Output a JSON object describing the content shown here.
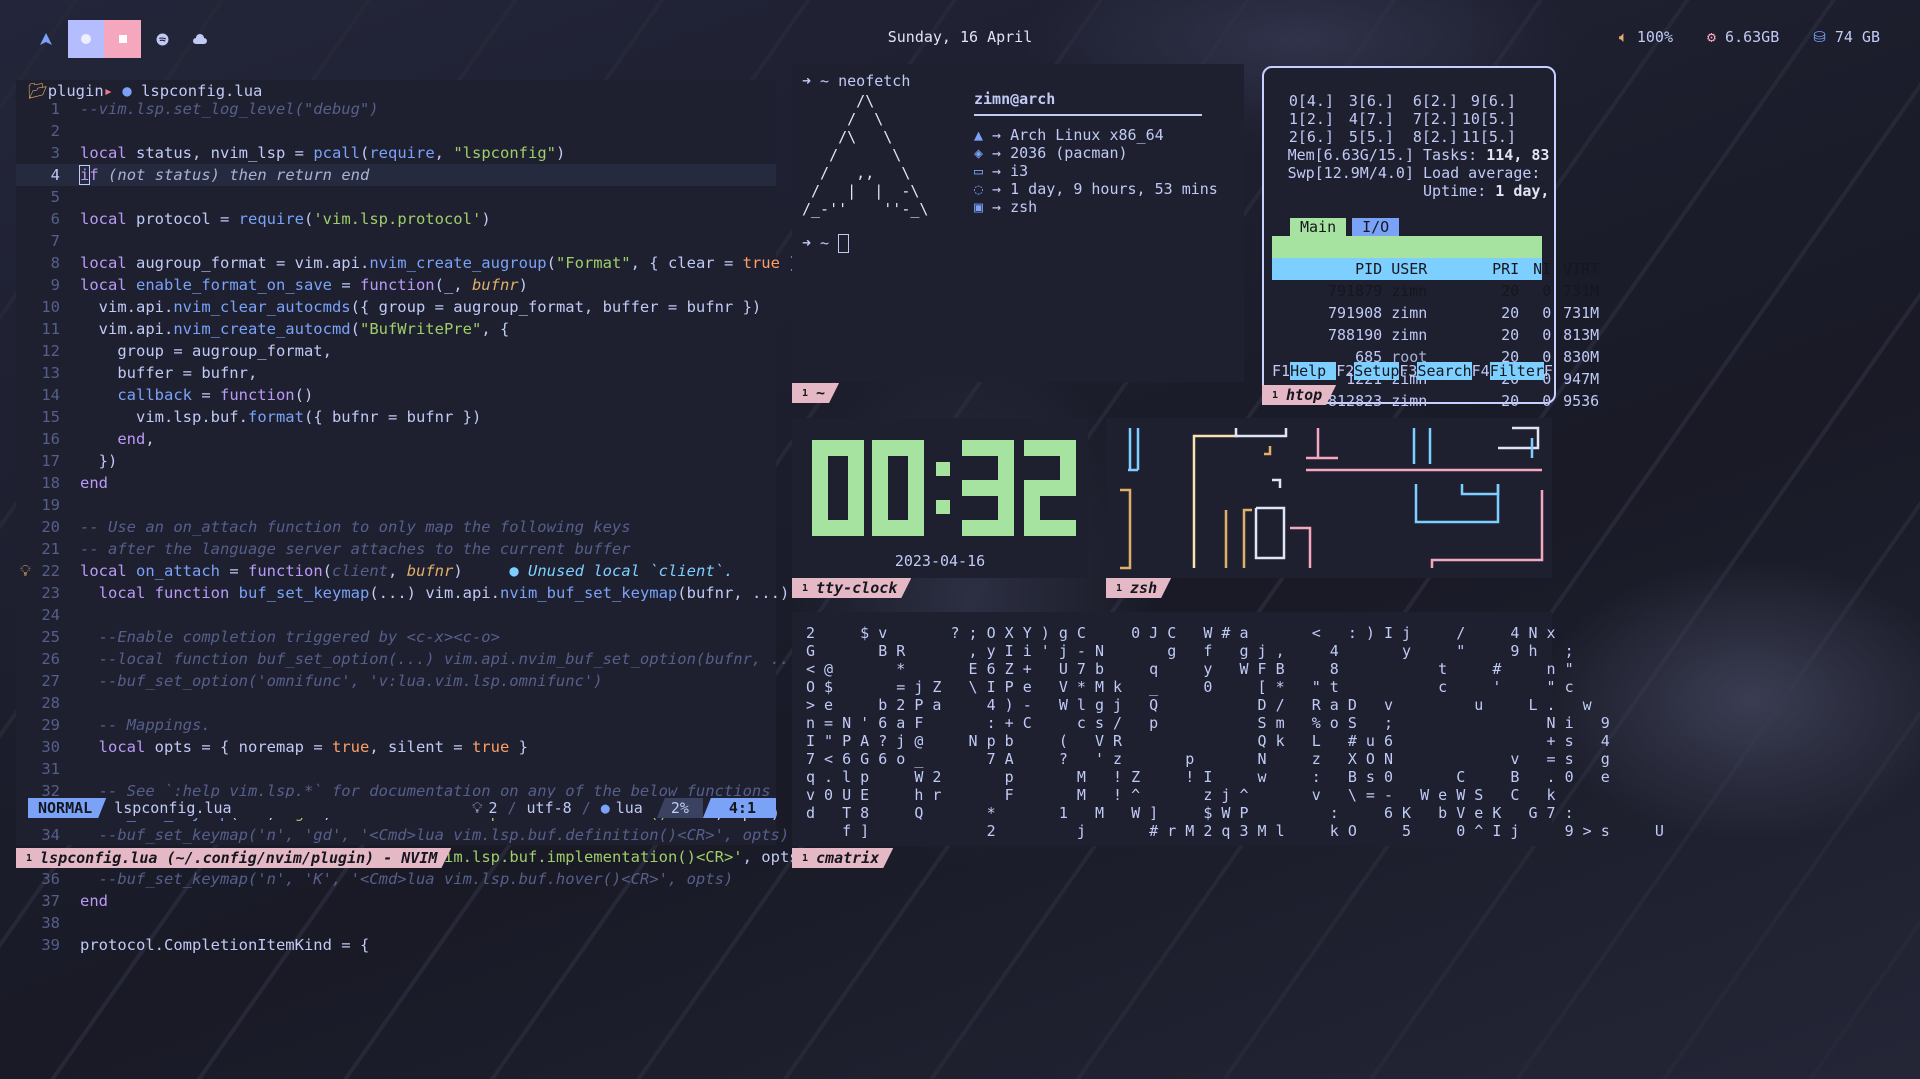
{
  "topbar": {
    "workspaces": [
      "A",
      "◐",
      "▣",
      "●",
      "☁"
    ],
    "date": "Sunday, 16 April",
    "volume": "100%",
    "memory": "6.63GB",
    "disk": "74 GB"
  },
  "nvim": {
    "breadcrumb_dir": "plugin",
    "breadcrumb_file": "lspconfig.lua",
    "mode": "NORMAL",
    "status_file": "lspconfig.lua",
    "status_hints": "2",
    "status_enc": "utf-8",
    "status_ft": "lua",
    "status_pct": "2%",
    "status_pos": "4:1",
    "tag": "lspconfig.lua (~/.config/nvim/plugin) - NVIM",
    "tag_num": "1",
    "diagnostic": "● Unused local `client`."
  },
  "neofetch": {
    "prompt": "➜ ~ neofetch",
    "prompt2": "➜ ~",
    "user": "zimn@arch",
    "os": "Arch Linux x86_64",
    "packages": "2036 (pacman)",
    "wm": "i3",
    "uptime": "1 day, 9 hours, 53 mins",
    "shell": "zsh",
    "tag": "~",
    "tag_num": "1"
  },
  "htop": {
    "cpus": [
      [
        "0[4.]",
        "3[6.]",
        "6[2.]",
        "9[6.]"
      ],
      [
        "1[2.]",
        "4[7.]",
        "7[2.]",
        "10[5.]"
      ],
      [
        "2[6.]",
        "5[5.]",
        "8[2.]",
        "11[5.]"
      ]
    ],
    "mem": "Mem[6.63G/15.]",
    "swp": "Swp[12.9M/4.0]",
    "tasks_label": "Tasks:",
    "tasks": "114, 83",
    "load_label": "Load average:",
    "uptime_label": "Uptime:",
    "uptime": "1 day,",
    "tab_main": "Main",
    "tab_io": "I/O",
    "headers": [
      "PID",
      "USER",
      "PRI",
      "NI",
      "VIRT"
    ],
    "rows": [
      [
        "791879",
        "zimn",
        "20",
        "0",
        "731M"
      ],
      [
        "791908",
        "zimn",
        "20",
        "0",
        "731M"
      ],
      [
        "788190",
        "zimn",
        "20",
        "0",
        "813M"
      ],
      [
        "685",
        "root",
        "20",
        "0",
        "830M"
      ],
      [
        "1221",
        "zimn",
        "20",
        "0",
        "947M"
      ],
      [
        "812823",
        "zimn",
        "20",
        "0",
        "9536"
      ]
    ],
    "fkeys": [
      [
        "F1",
        "Help"
      ],
      [
        "F2",
        "Setup"
      ],
      [
        "F3",
        "Search"
      ],
      [
        "F4",
        "Filter"
      ],
      [
        "F",
        ""
      ]
    ],
    "tag": "htop",
    "tag_num": "1"
  },
  "clock": {
    "time": "00:32",
    "date": "2023-04-16",
    "tag": "tty-clock",
    "tag_num": "1"
  },
  "pipes": {
    "tag": "zsh",
    "tag_num": "1"
  },
  "cmatrix": {
    "tag": "cmatrix",
    "tag_num": "1"
  },
  "colors": {
    "accent_blue": "#7aa2f7",
    "accent_pink": "#e5b8c6",
    "clock_green": "#a6e3a1",
    "htop_cyan": "#7dcfff"
  }
}
